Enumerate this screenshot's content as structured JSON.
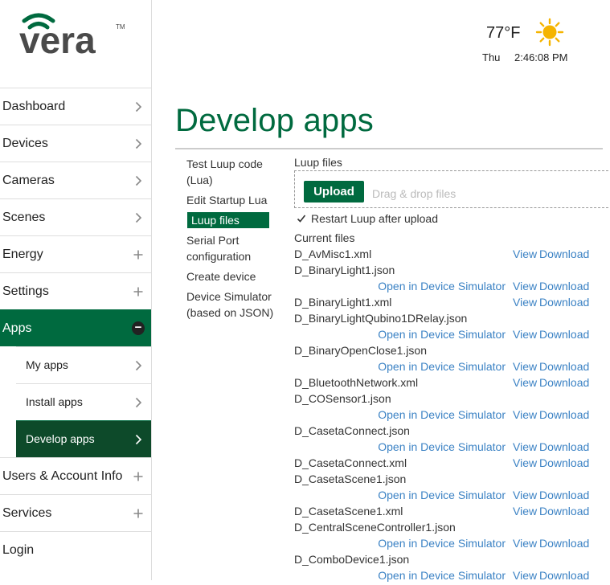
{
  "brand": {
    "name": "vera",
    "colors": {
      "primary": "#006a3f",
      "logo_gray": "#4a4a4a",
      "link": "#3b82c4"
    }
  },
  "header": {
    "temperature": "77°F",
    "day": "Thu",
    "time": "2:46:08 PM",
    "weather_icon": "sun-icon"
  },
  "sidebar": {
    "items": [
      {
        "label": "Dashboard",
        "icon": "chevron-right-icon"
      },
      {
        "label": "Devices",
        "icon": "chevron-right-icon"
      },
      {
        "label": "Cameras",
        "icon": "chevron-right-icon"
      },
      {
        "label": "Scenes",
        "icon": "chevron-right-icon"
      },
      {
        "label": "Energy",
        "icon": "plus-icon"
      },
      {
        "label": "Settings",
        "icon": "plus-icon"
      },
      {
        "label": "Apps",
        "icon": "minus-circle-icon",
        "active": true
      },
      {
        "label": "My apps",
        "icon": "chevron-right-icon",
        "sub": true
      },
      {
        "label": "Install apps",
        "icon": "chevron-right-icon",
        "sub": true
      },
      {
        "label": "Develop apps",
        "icon": "chevron-right-icon",
        "sub": true,
        "active": true
      },
      {
        "label": "Users & Account Info",
        "icon": "plus-icon"
      },
      {
        "label": "Services",
        "icon": "plus-icon"
      },
      {
        "label": "Login",
        "icon": ""
      }
    ]
  },
  "page": {
    "title": "Develop apps"
  },
  "submenu": [
    "Test Luup code (Lua)",
    "Edit Startup Lua",
    "Luup files",
    "Serial Port configuration",
    "Create device",
    "Device Simulator (based on JSON)"
  ],
  "luup": {
    "heading": "Luup files",
    "upload_label": "Upload",
    "dropzone_text": "Drag & drop files",
    "restart_label": "Restart Luup after upload",
    "restart_checked": true,
    "current_files_label": "Current files",
    "open_sim_label": "Open in Device Simulator",
    "view_label": "View",
    "download_label": "Download",
    "files": [
      {
        "name": "D_AvMisc1.xml"
      },
      {
        "name": "D_BinaryLight1.json",
        "sim": true
      },
      {
        "name": "D_BinaryLight1.xml"
      },
      {
        "name": "D_BinaryLightQubino1DRelay.json",
        "sim": true
      },
      {
        "name": "D_BinaryOpenClose1.json",
        "sim": true
      },
      {
        "name": "D_BluetoothNetwork.xml"
      },
      {
        "name": "D_COSensor1.json",
        "sim": true
      },
      {
        "name": "D_CasetaConnect.json",
        "sim": true
      },
      {
        "name": "D_CasetaConnect.xml"
      },
      {
        "name": "D_CasetaScene1.json",
        "sim": true
      },
      {
        "name": "D_CasetaScene1.xml"
      },
      {
        "name": "D_CentralSceneController1.json",
        "sim": true
      },
      {
        "name": "D_ComboDevice1.json",
        "sim": true
      }
    ]
  }
}
